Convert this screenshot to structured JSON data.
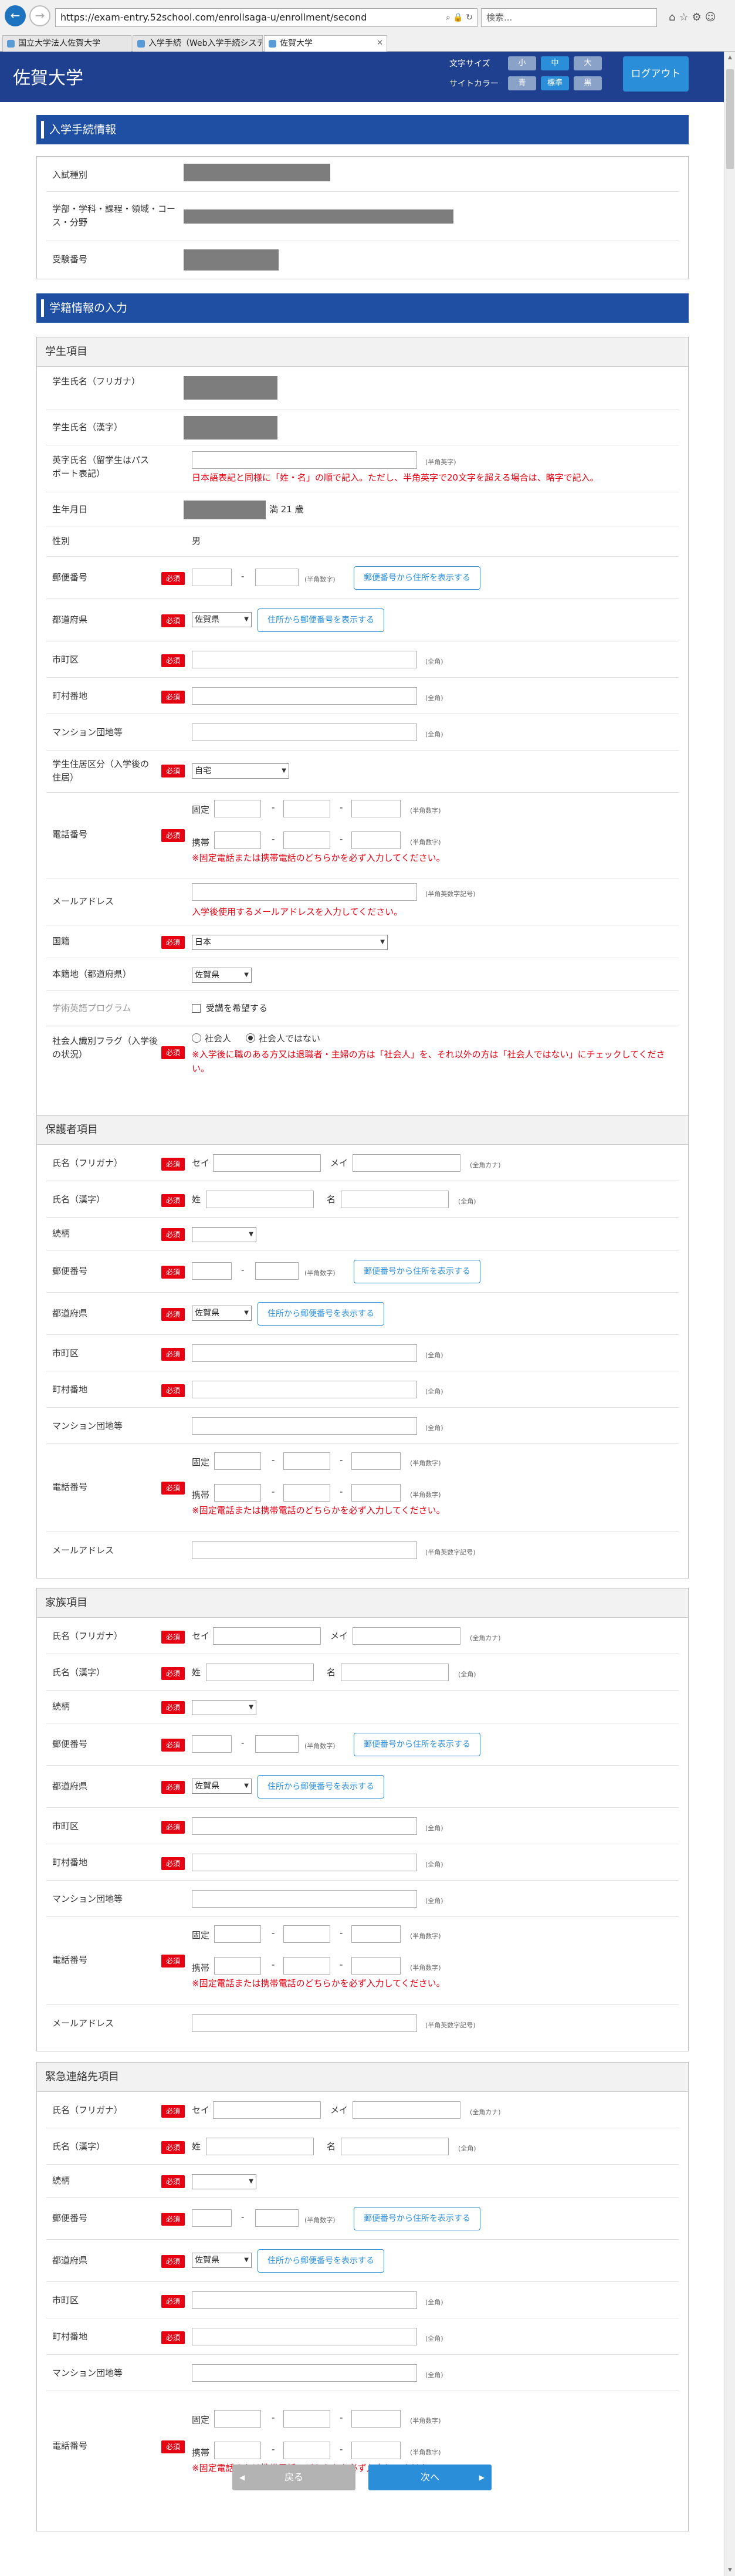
{
  "browser": {
    "url": "https://exam-entry.52school.com/enrollsaga-u/enrollment/second",
    "search_placeholder": "検索...",
    "tabs": [
      {
        "label": "国立大学法人佐賀大学"
      },
      {
        "label": "入学手続（Web入学手続システ..."
      },
      {
        "label": "佐賀大学"
      }
    ]
  },
  "header": {
    "title": "佐賀大学",
    "font_size_label": "文字サイズ",
    "site_color_label": "サイトカラー",
    "font_size_options": [
      "小",
      "中",
      "大"
    ],
    "color_options": [
      "青",
      "標準",
      "黒"
    ],
    "logout": "ログアウト"
  },
  "sections": {
    "enroll_title": "入学手続情報",
    "enroll": {
      "exam_type": "入試種別",
      "dept": "学部・学科・課程・領域・コース・分野",
      "exam_no": "受験番号"
    },
    "register_title": "学籍情報の入力"
  },
  "common": {
    "required": "必須",
    "zip_button": "郵便番号から住所を表示する",
    "pref_button": "住所から郵便番号を表示する",
    "hint_halfnum": "(半角数字)",
    "hint_full": "(全角)",
    "hint_fullkana": "(全角カナ)",
    "hint_halfalnum": "(半角英数字記号)",
    "fixed": "固定",
    "mobile": "携帯",
    "phone_note": "※固定電話または携帯電話のどちらかを必ず入力してください。",
    "sei": "セイ",
    "mei": "メイ",
    "sei_kanji": "姓",
    "mei_kanji": "名",
    "dash": "-",
    "pref_default": "佐賀県"
  },
  "student": {
    "title": "学生項目",
    "name_kana": "学生氏名（フリガナ）",
    "name_kanji": "学生氏名（漢字）",
    "name_roman": "英字氏名（留学生はパスポート表記）",
    "roman_hint": "(半角英字)",
    "roman_note": "日本語表記と同様に「姓・名」の順で記入。ただし、半角英字で20文字を超える場合は、略字で記入。",
    "birth": "生年月日",
    "age_suffix": "満 21 歳",
    "gender": "性別",
    "gender_value": "男",
    "zip": "郵便番号",
    "pref": "都道府県",
    "city": "市町区",
    "town": "町村番地",
    "building": "マンション団地等",
    "residence": "学生住居区分（入学後の住居）",
    "residence_value": "自宅",
    "phone": "電話番号",
    "email": "メールアドレス",
    "email_note": "入学後使用するメールアドレスを入力してください。",
    "nationality": "国籍",
    "nationality_value": "日本",
    "honseki": "本籍地（都道府県）",
    "english": "学術英語プログラム",
    "english_check": "受講を希望する",
    "adult": "社会人識別フラグ（入学後の状況）",
    "adult_yes": "社会人",
    "adult_no": "社会人ではない",
    "adult_note": "※入学後に職のある方又は退職者・主婦の方は「社会人」を、それ以外の方は「社会人ではない」にチェックしてください。"
  },
  "guardian": {
    "title": "保護者項目",
    "name_kana": "氏名（フリガナ）",
    "name_kanji": "氏名（漢字）",
    "relation": "続柄",
    "zip": "郵便番号",
    "pref": "都道府県",
    "city": "市町区",
    "town": "町村番地",
    "building": "マンション団地等",
    "phone": "電話番号",
    "email": "メールアドレス"
  },
  "family": {
    "title": "家族項目",
    "name_kana": "氏名（フリガナ）",
    "name_kanji": "氏名（漢字）",
    "relation": "続柄",
    "zip": "郵便番号",
    "pref": "都道府県",
    "city": "市町区",
    "town": "町村番地",
    "building": "マンション団地等",
    "phone": "電話番号",
    "email": "メールアドレス"
  },
  "emergency": {
    "title": "緊急連絡先項目",
    "name_kana": "氏名（フリガナ）",
    "name_kanji": "氏名（漢字）",
    "relation": "続柄",
    "zip": "郵便番号",
    "pref": "都道府県",
    "city": "市町区",
    "town": "町村番地",
    "building": "マンション団地等",
    "phone": "電話番号"
  },
  "footer": {
    "prev": "戻る",
    "next": "次へ"
  }
}
